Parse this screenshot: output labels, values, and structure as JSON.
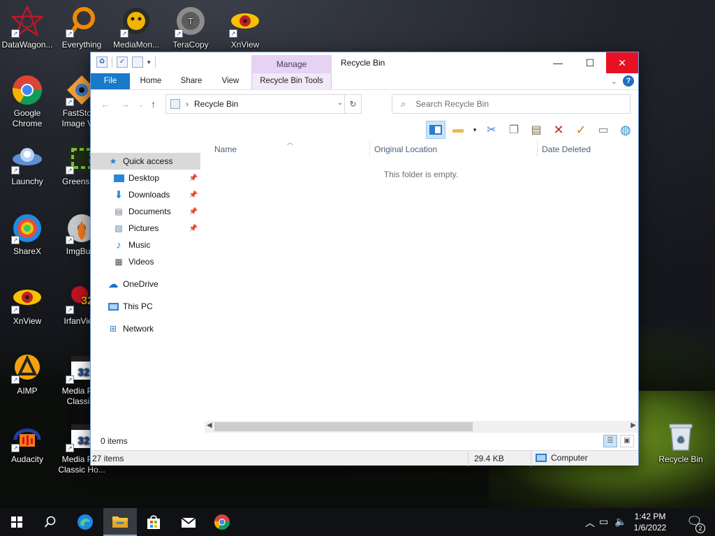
{
  "desktop": {
    "icons": [
      {
        "label": "DataWagon..."
      },
      {
        "label": "Everything"
      },
      {
        "label": "MediaMon..."
      },
      {
        "label": "TeraCopy"
      },
      {
        "label": "XnView"
      },
      {
        "label": "Google Chrome"
      },
      {
        "label": "FastStone Image Vi..."
      },
      {
        "label": "Launchy"
      },
      {
        "label": "Greensh..."
      },
      {
        "label": "ShareX"
      },
      {
        "label": "ImgBu..."
      },
      {
        "label": "XnView"
      },
      {
        "label": "IrfanVie..."
      },
      {
        "label": "AIMP"
      },
      {
        "label": "Media Pl... Classi..."
      },
      {
        "label": "Audacity"
      },
      {
        "label": "Media Pl... Classic Ho..."
      },
      {
        "label": "Recycle Bin"
      }
    ]
  },
  "window": {
    "title": "Recycle Bin",
    "manage_tab": "Manage",
    "controls": {
      "minimize": "—",
      "maximize": "☐",
      "close": "✕"
    },
    "ribbon_tabs": [
      "File",
      "Home",
      "Share",
      "View",
      "Recycle Bin Tools"
    ],
    "help": "?",
    "address": {
      "path": "Recycle Bin"
    },
    "search": {
      "placeholder": "Search Recycle Bin"
    },
    "nav": {
      "quick_access": "Quick access",
      "items": [
        {
          "label": "Desktop",
          "pinned": true
        },
        {
          "label": "Downloads",
          "pinned": true
        },
        {
          "label": "Documents",
          "pinned": true
        },
        {
          "label": "Pictures",
          "pinned": true
        },
        {
          "label": "Music",
          "pinned": false
        },
        {
          "label": "Videos",
          "pinned": false
        }
      ],
      "onedrive": "OneDrive",
      "this_pc": "This PC",
      "network": "Network"
    },
    "columns": [
      "Name",
      "Original Location",
      "Date Deleted"
    ],
    "empty_message": "This folder is empty.",
    "status": {
      "count": "0 items"
    },
    "details_bar": {
      "items": "27 items",
      "size": "29.4 KB",
      "location": "Computer"
    }
  },
  "taskbar": {
    "clock_time": "1:42 PM",
    "clock_date": "1/6/2022",
    "notification_count": "2"
  },
  "colors": {
    "file_tab": "#1979ca",
    "manage_tab": "#e6d2f3",
    "close": "#e81123",
    "accent": "#1979ca"
  }
}
